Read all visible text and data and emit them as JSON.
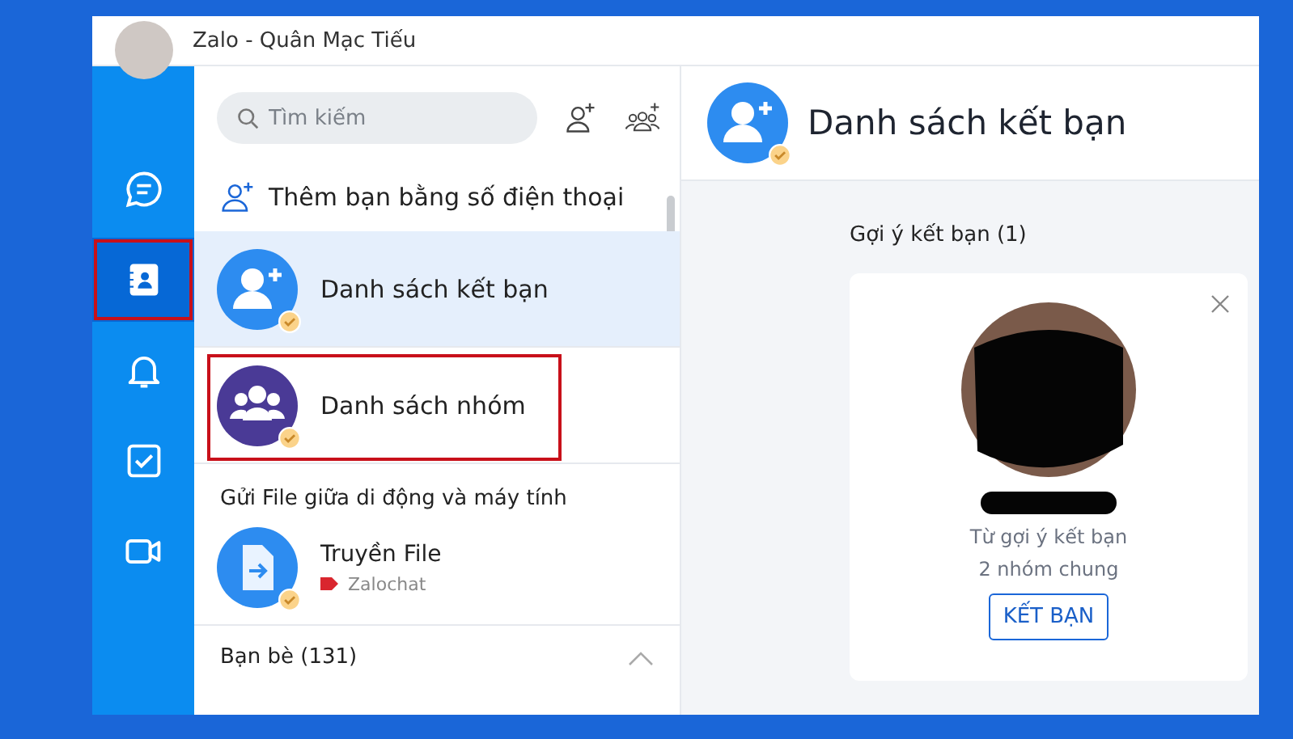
{
  "window": {
    "title": "Zalo - Quân Mạc Tiếu"
  },
  "rail": {
    "items": [
      {
        "kind": "chat",
        "selected": false,
        "highlighted": false
      },
      {
        "kind": "contacts",
        "selected": true,
        "highlighted": true
      },
      {
        "kind": "bell",
        "selected": false,
        "highlighted": false
      },
      {
        "kind": "todo",
        "selected": false,
        "highlighted": false
      },
      {
        "kind": "video",
        "selected": false,
        "highlighted": false
      }
    ]
  },
  "search": {
    "placeholder": "Tìm kiếm"
  },
  "add_by_phone": {
    "label": "Thêm bạn bằng số điện thoại"
  },
  "menu": [
    {
      "kind": "friend-requests",
      "label": "Danh sách kết bạn",
      "selected": true,
      "highlighted": false
    },
    {
      "kind": "groups",
      "label": "Danh sách nhóm",
      "selected": false,
      "highlighted": true
    }
  ],
  "file_section": {
    "heading": "Gửi File giữa di động và máy tính",
    "item": {
      "name": "Truyền File",
      "tag": "Zalochat"
    }
  },
  "friends_section": {
    "heading": "Bạn bè (131)",
    "expanded": true
  },
  "main": {
    "title": "Danh sách kết bạn",
    "suggestions_heading": "Gợi ý kết bạn (1)",
    "card": {
      "source": "Từ gợi ý kết bạn",
      "mutual": "2 nhóm chung",
      "button": "KẾT BẠN"
    }
  }
}
